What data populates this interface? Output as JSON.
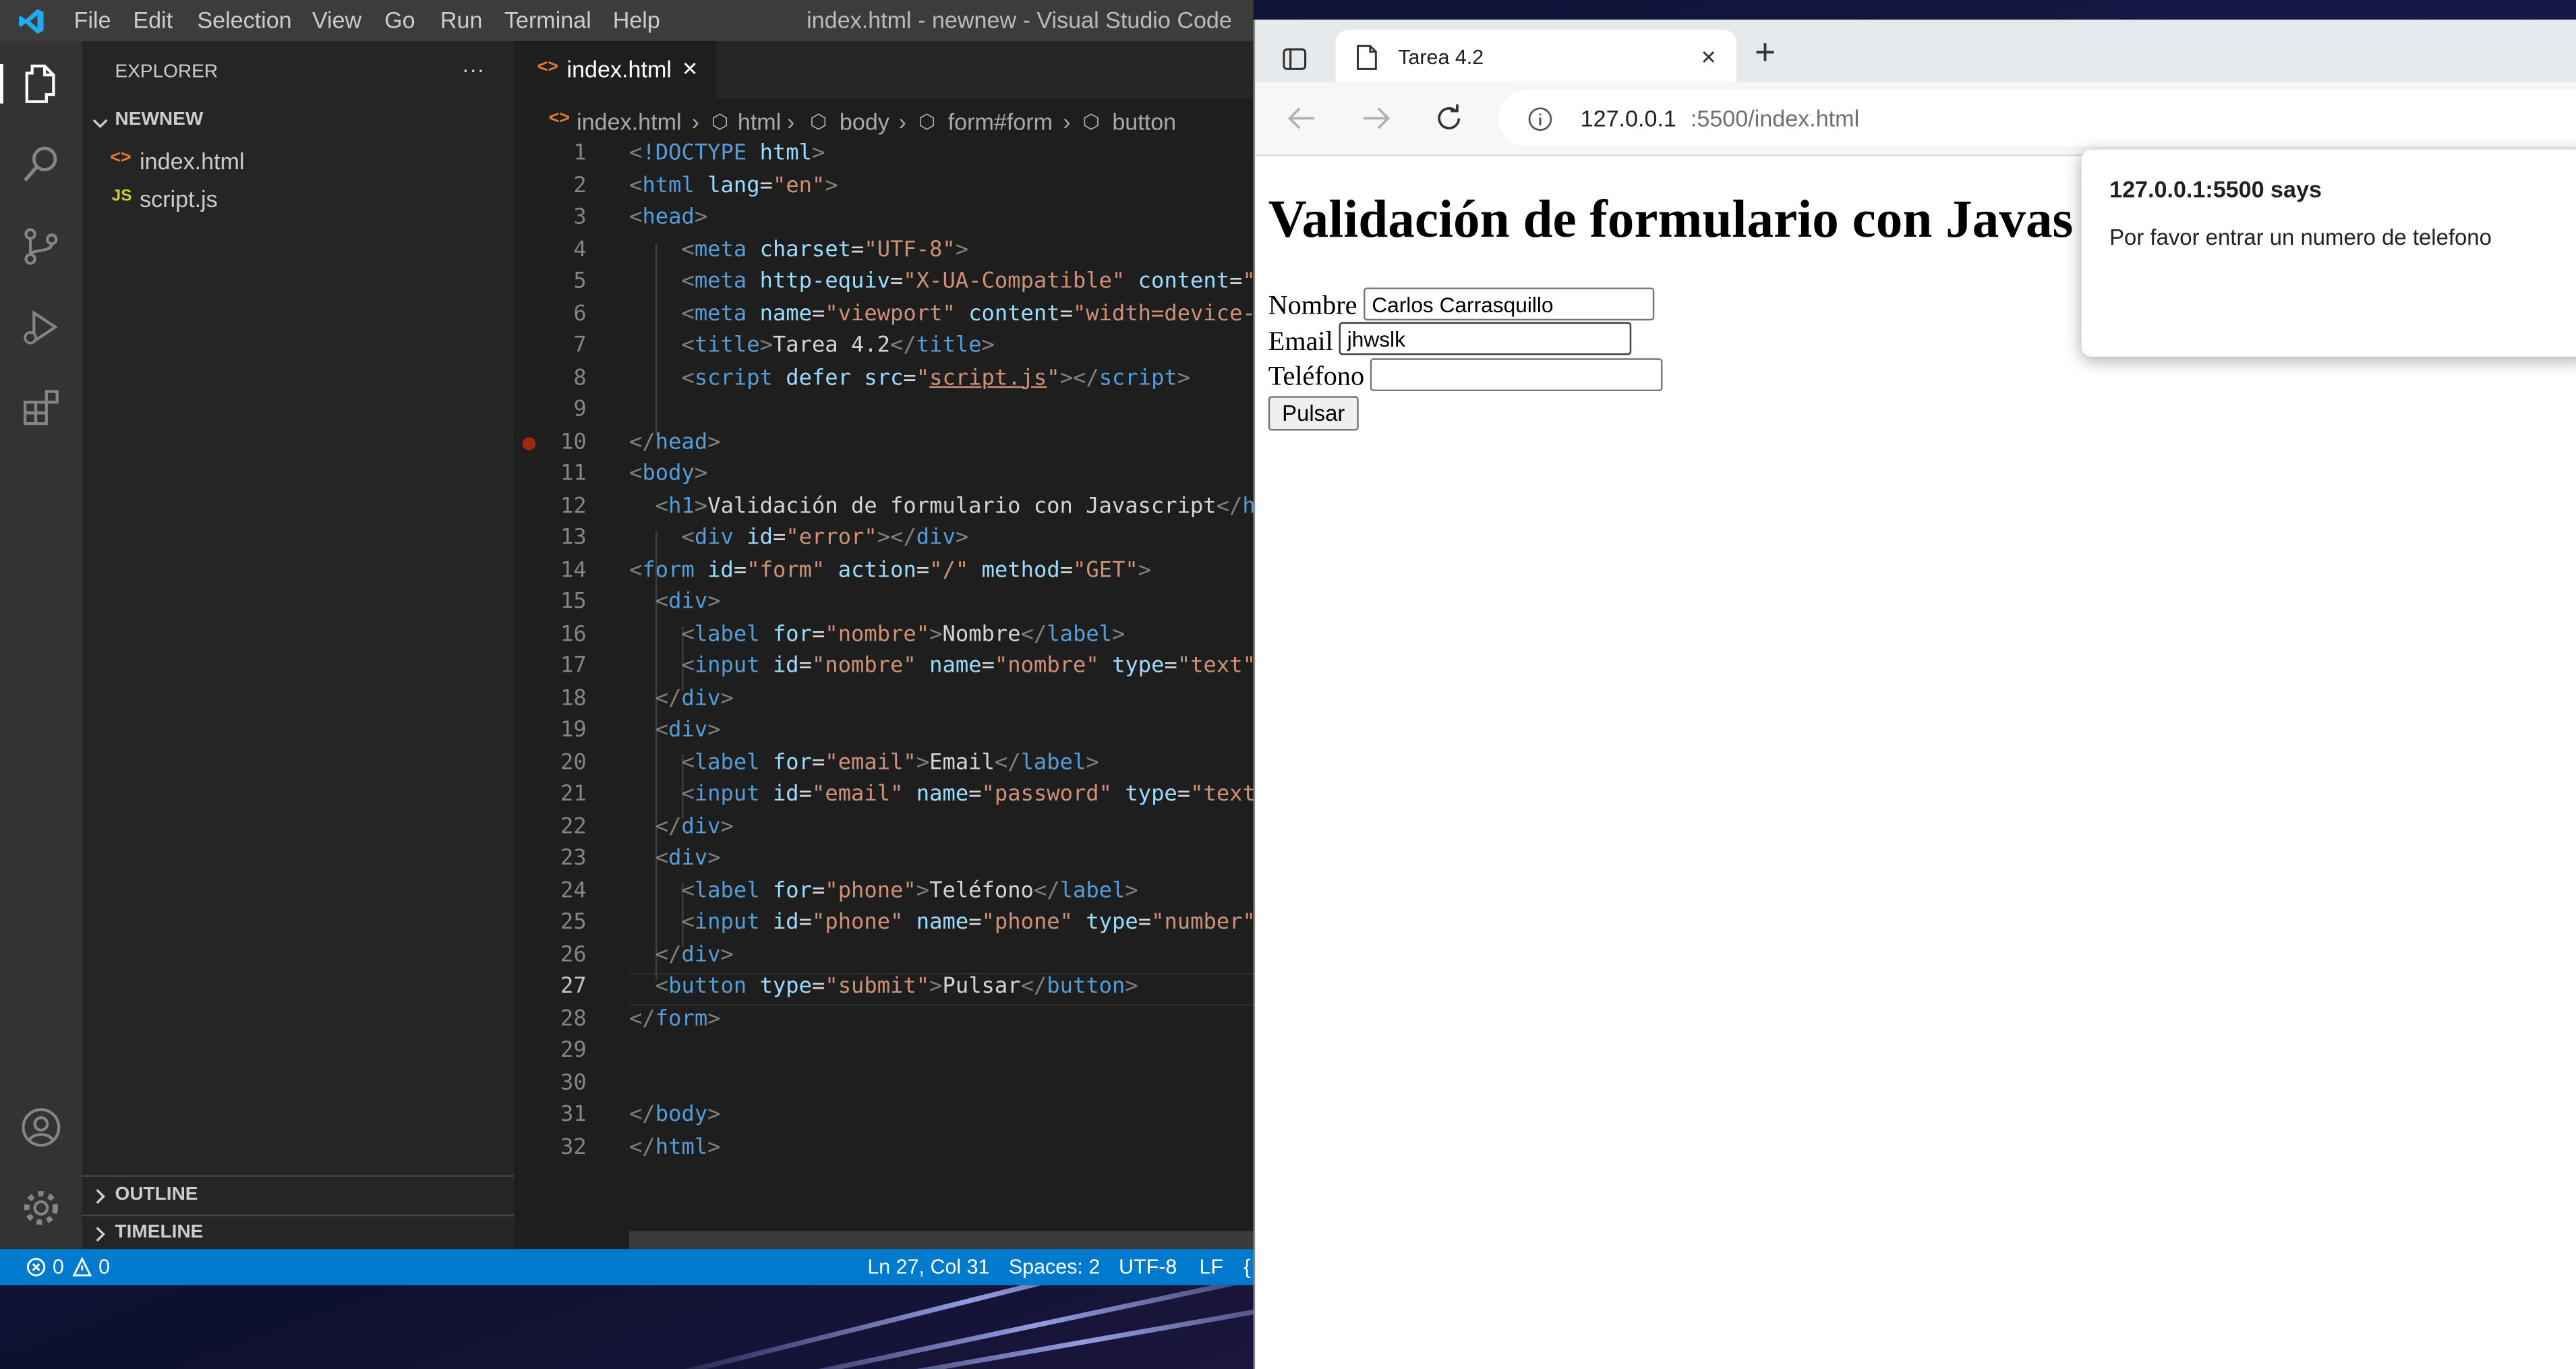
{
  "vscode": {
    "title": "index.html - newnew - Visual Studio Code",
    "menu": [
      "File",
      "Edit",
      "Selection",
      "View",
      "Go",
      "Run",
      "Terminal",
      "Help"
    ],
    "explorer": {
      "header": "EXPLORER",
      "more": "···",
      "folder": "NEWNEW",
      "files": [
        {
          "label": "index.html",
          "icon": "<>"
        },
        {
          "label": "script.js",
          "icon": "JS"
        }
      ],
      "outline": "OUTLINE",
      "timeline": "TIMELINE"
    },
    "tab": {
      "label": "index.html",
      "icon": "<>",
      "close": "✕"
    },
    "breadcrumb": [
      "index.html",
      "html",
      "body",
      "form#form",
      "button"
    ],
    "line_numbers": [
      "1",
      "2",
      "3",
      "4",
      "5",
      "6",
      "7",
      "8",
      "9",
      "10",
      "11",
      "12",
      "13",
      "14",
      "15",
      "16",
      "17",
      "18",
      "19",
      "20",
      "21",
      "22",
      "23",
      "24",
      "25",
      "26",
      "27",
      "28",
      "29",
      "30",
      "31",
      "32"
    ],
    "status": {
      "errors": "0",
      "warnings": "0",
      "position": "Ln 27, Col 31",
      "spaces": "Spaces: 2",
      "encoding": "UTF-8",
      "eol": "LF",
      "lang_brace": "{"
    }
  },
  "browser": {
    "tab_title": "Tarea 4.2",
    "tab_close": "✕",
    "new_tab": "+",
    "url_host": "127.0.0.1",
    "url_rest": ":5500/index.html",
    "page": {
      "heading": "Validación de formulario con Javas",
      "nombre_label": "Nombre",
      "nombre_value": "Carlos Carrasquillo",
      "email_label": "Email",
      "email_value": "jhwslk",
      "phone_label": "Teléfono",
      "phone_value": "",
      "submit": "Pulsar"
    },
    "dialog": {
      "title": "127.0.0.1:5500 says",
      "message": "Por favor entrar un numero de telefono"
    }
  }
}
